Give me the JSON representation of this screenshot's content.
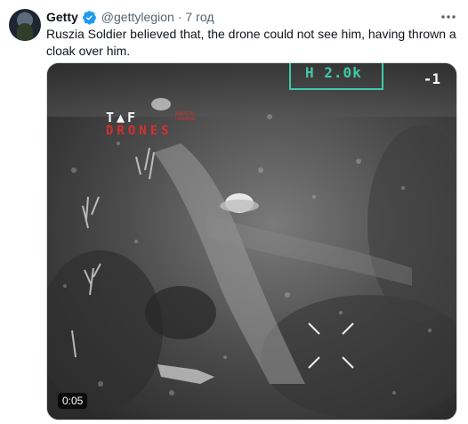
{
  "post": {
    "author_name": "Getty",
    "handle": "@gettylegion",
    "separator": "·",
    "time": "7 год",
    "text": "Ruszia Soldier believed that, the drone could not see him, having thrown a cloak over him."
  },
  "media": {
    "logo_top": "T▲F",
    "logo_bottom": "DRONES",
    "logo_tag": "MADE IN UKRAINE",
    "hud_readout": "H 2.0k",
    "hud_corner": "-1",
    "duration": "0:05"
  },
  "colors": {
    "verified_badge": "#1d9bf0",
    "hud": "#3ec9a6",
    "logo_red": "#d6302f"
  },
  "icons": [
    "verified-badge-icon",
    "more-options-icon",
    "crosshair-icon"
  ]
}
